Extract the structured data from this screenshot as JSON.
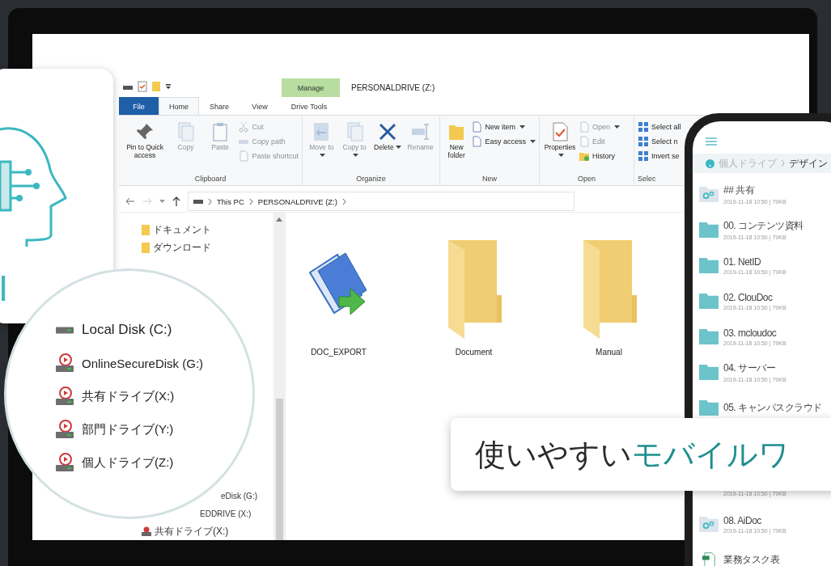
{
  "window": {
    "title": "PERSONALDRIVE (Z:)",
    "context_header": "Manage"
  },
  "tabs": [
    {
      "label": "File",
      "kind": "file",
      "selected": false
    },
    {
      "label": "Home",
      "kind": "normal",
      "selected": true
    },
    {
      "label": "Share",
      "kind": "normal",
      "selected": false
    },
    {
      "label": "View",
      "kind": "normal",
      "selected": false
    },
    {
      "label": "Drive Tools",
      "kind": "context",
      "selected": false
    }
  ],
  "ribbon": {
    "groups": [
      {
        "label": "Clipboard",
        "large": [
          {
            "label": "Pin to Quick access",
            "disabled": false,
            "dropdown": false
          },
          {
            "label": "Copy",
            "disabled": true,
            "dropdown": false
          },
          {
            "label": "Paste",
            "disabled": true,
            "dropdown": false
          }
        ],
        "small": [
          {
            "label": "Cut",
            "disabled": true,
            "dropdown": false
          },
          {
            "label": "Copy path",
            "disabled": true,
            "dropdown": false
          },
          {
            "label": "Paste shortcut",
            "disabled": true,
            "dropdown": false
          }
        ]
      },
      {
        "label": "Organize",
        "large": [
          {
            "label": "Move to",
            "disabled": true,
            "dropdown": true
          },
          {
            "label": "Copy to",
            "disabled": true,
            "dropdown": true
          },
          {
            "label": "Delete",
            "disabled": false,
            "dropdown": true
          },
          {
            "label": "Rename",
            "disabled": true,
            "dropdown": false
          }
        ]
      },
      {
        "label": "New",
        "large": [
          {
            "label": "New folder",
            "disabled": false,
            "dropdown": false
          }
        ],
        "small": [
          {
            "label": "New item",
            "disabled": false,
            "dropdown": true
          },
          {
            "label": "Easy access",
            "disabled": false,
            "dropdown": true
          }
        ]
      },
      {
        "label": "Open",
        "large": [
          {
            "label": "Properties",
            "disabled": false,
            "dropdown": true
          }
        ],
        "small": [
          {
            "label": "Open",
            "disabled": true,
            "dropdown": true
          },
          {
            "label": "Edit",
            "disabled": true,
            "dropdown": false
          },
          {
            "label": "History",
            "disabled": false,
            "dropdown": false
          }
        ]
      },
      {
        "label": "Selec",
        "small": [
          {
            "label": "Select all",
            "disabled": false,
            "dropdown": false
          },
          {
            "label": "Select n",
            "disabled": false,
            "dropdown": false
          },
          {
            "label": "Invert se",
            "disabled": false,
            "dropdown": false
          }
        ]
      }
    ]
  },
  "address_bar": {
    "path": [
      "This PC",
      "PERSONALDRIVE (Z:)"
    ]
  },
  "nav_pane": {
    "items": [
      {
        "label": "ドキュメント",
        "kind": "folder"
      },
      {
        "label": "ダウンロード",
        "kind": "folder"
      }
    ],
    "clipped_items": [
      {
        "label": "eDisk (G:)",
        "kind": "text"
      },
      {
        "label": "EDDRIVE (X:)",
        "kind": "text"
      },
      {
        "label": "共有ドライブ(X:)",
        "kind": "drive"
      }
    ]
  },
  "files": [
    {
      "name": "DOC_EXPORT",
      "kind": "export"
    },
    {
      "name": "Document",
      "kind": "folder"
    },
    {
      "name": "Manual",
      "kind": "folder"
    }
  ],
  "magnifier": {
    "items": [
      {
        "label": "Local Disk (C:)",
        "kind": "local"
      },
      {
        "label": "OnlineSecureDisk (G:)",
        "kind": "network"
      },
      {
        "label": "共有ドライブ(X:)",
        "kind": "network"
      },
      {
        "label": "部門ドライブ(Y:)",
        "kind": "network"
      },
      {
        "label": "個人ドライブ(Z:)",
        "kind": "network"
      }
    ]
  },
  "ai_card": {
    "label": "I"
  },
  "phone": {
    "breadcrumb": [
      "個人ドライブ",
      "デザイン"
    ],
    "items": [
      {
        "kind": "shared",
        "name": "## 共有",
        "meta": "2019-11-18 10:50 | 79KB"
      },
      {
        "kind": "folder",
        "name": "00. コンテンツ資料",
        "meta": "2019-11-18 10:50 | 79KB"
      },
      {
        "kind": "folder",
        "name": "01. NetID",
        "meta": "2019-11-18 10:50 | 79KB"
      },
      {
        "kind": "folder",
        "name": "02. ClouDoc",
        "meta": "2019-11-18 10:50 | 79KB"
      },
      {
        "kind": "folder",
        "name": "03. mcloudoc",
        "meta": "2019-11-18 10:50 | 79KB"
      },
      {
        "kind": "folder",
        "name": "04. サーバー",
        "meta": "2019-11-18 10:50 | 79KB"
      },
      {
        "kind": "folder",
        "name": "05. キャンパスクラウド"
      },
      {
        "meta": "2019-11-18 10:50 | 79KB"
      },
      {
        "kind": "shared",
        "name": "08. AiDoc",
        "meta": "2019-11-18 10:50 | 79KB"
      },
      {
        "kind": "xls",
        "name": "業務タスク表"
      }
    ]
  },
  "banner": {
    "lead": "使いやすい",
    "highlight": "モバイルワ"
  }
}
